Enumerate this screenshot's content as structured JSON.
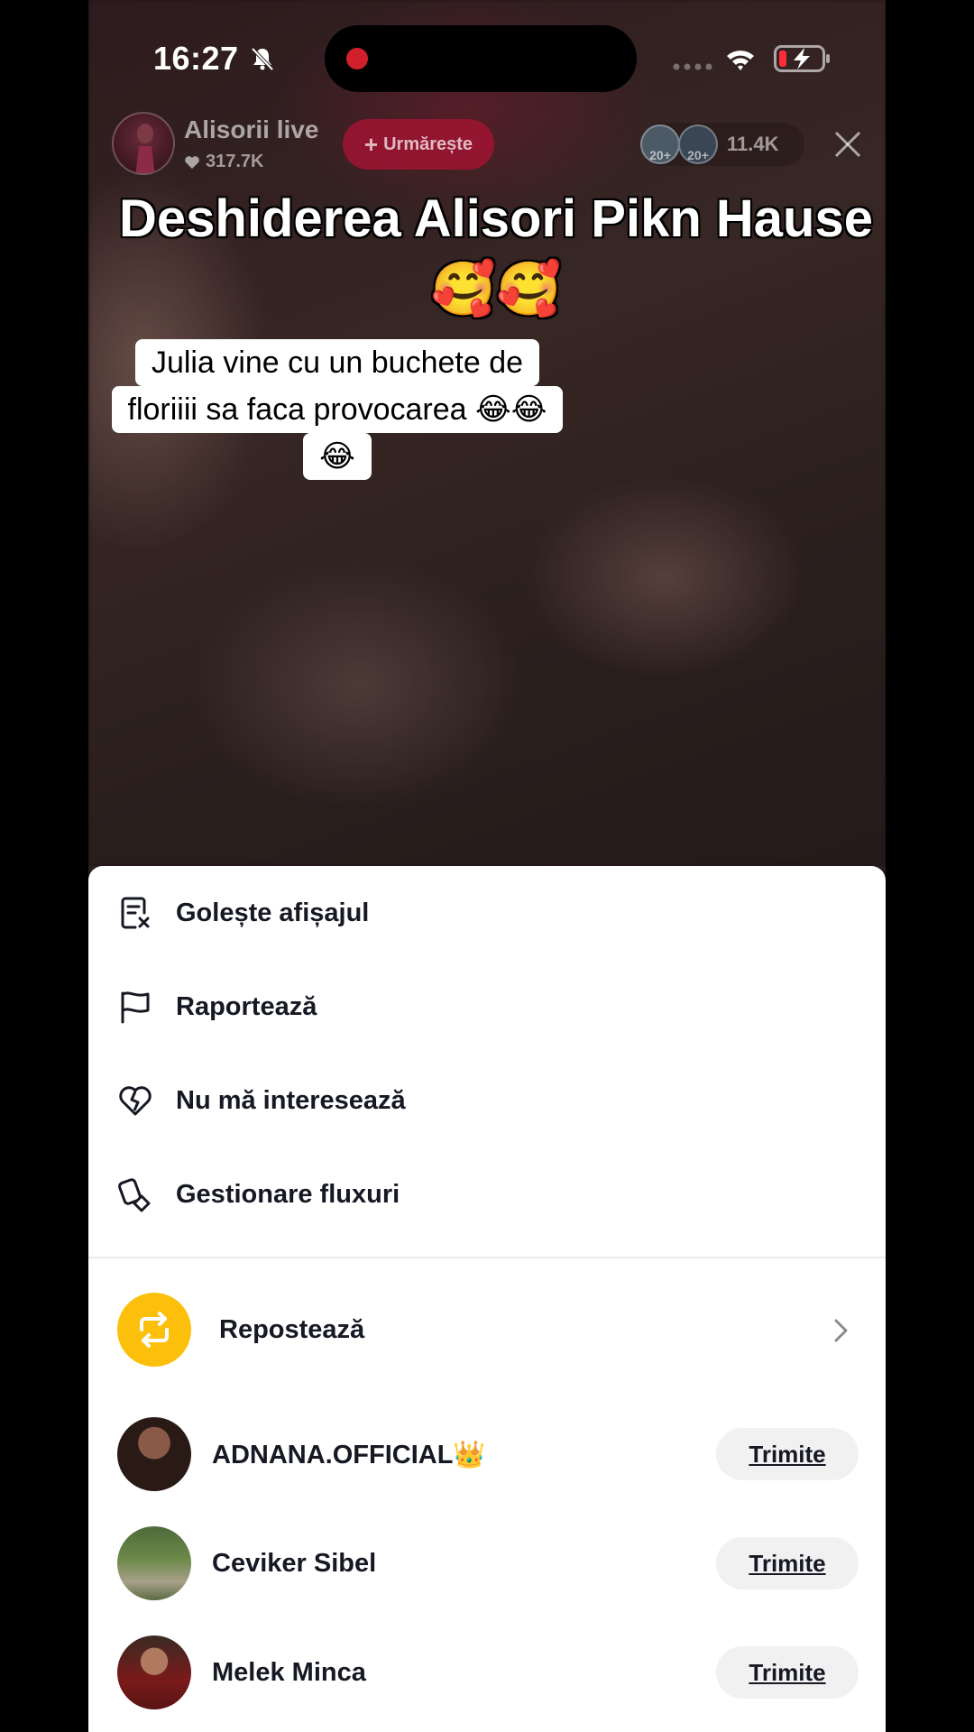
{
  "status_bar": {
    "time": "16:27"
  },
  "live": {
    "host_name": "Alisorii live",
    "likes": "317.7K",
    "follow_label": "Urmărește",
    "viewer_badges": [
      "20+",
      "20+"
    ],
    "viewer_count": "11.4K"
  },
  "caption": {
    "line1": "Deshiderea Alisori Pikn Hause",
    "line2": "🥰🥰"
  },
  "note": {
    "line1": "Julia vine cu un buchete de",
    "line2": "floriiii sa faca provocarea 😂😂",
    "line3": "😂"
  },
  "sheet": {
    "menu": [
      {
        "label": "Golește afișajul",
        "icon": "clear-display-icon"
      },
      {
        "label": "Raportează",
        "icon": "flag-icon"
      },
      {
        "label": "Nu mă interesează",
        "icon": "broken-heart-icon"
      },
      {
        "label": "Gestionare fluxuri",
        "icon": "manage-feed-icon"
      }
    ],
    "repost_label": "Repostează",
    "contacts": [
      {
        "name": "ADNANA.OFFICIAL👑",
        "send_label": "Trimite"
      },
      {
        "name": "Ceviker Sibel",
        "send_label": "Trimite"
      },
      {
        "name": "Melek Minca",
        "send_label": "Trimite"
      }
    ]
  },
  "colors": {
    "repost_accent": "#fcc00c",
    "follow_button": "#a01432",
    "text": "#161823"
  }
}
